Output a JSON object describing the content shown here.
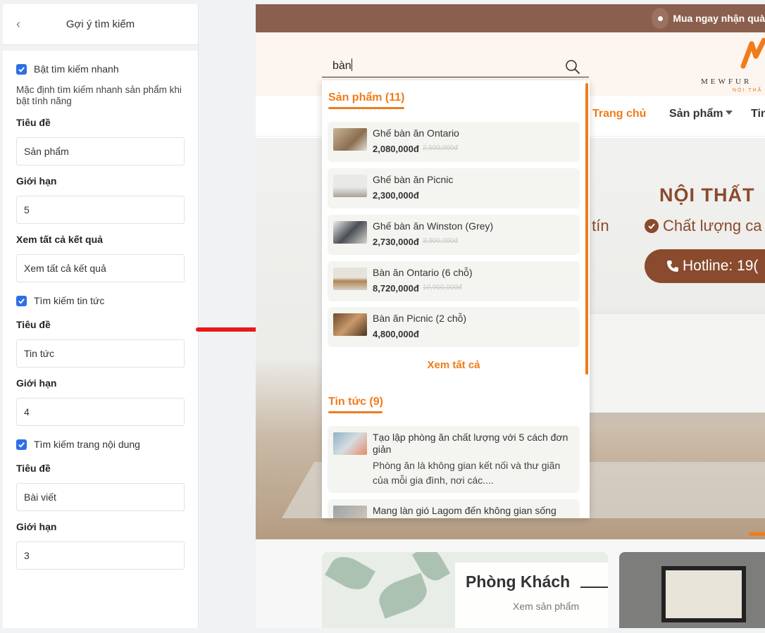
{
  "panel": {
    "title": "Gợi ý tìm kiếm",
    "quick_search": {
      "label": "Bật tìm kiếm nhanh",
      "checked": true
    },
    "note": "Mặc định tìm kiếm nhanh sản phẩm khi bật tính năng",
    "product_title_label": "Tiêu đề",
    "product_title_value": "Sản phẩm",
    "product_limit_label": "Giới hạn",
    "product_limit_value": "5",
    "view_all_label": "Xem tất cả kết quả",
    "view_all_value": "Xem tất cả kết quả",
    "news_search": {
      "label": "Tìm kiếm tin tức",
      "checked": true
    },
    "news_title_label": "Tiêu đề",
    "news_title_value": "Tin tức",
    "news_limit_label": "Giới hạn",
    "news_limit_value": "4",
    "page_search": {
      "label": "Tìm kiếm trang nội dung",
      "checked": true
    },
    "page_title_label": "Tiêu đề",
    "page_title_value": "Bài viết",
    "page_limit_label": "Giới hạn",
    "page_limit_value": "3"
  },
  "site": {
    "promo": "Mua ngay nhận quà",
    "search_value": "bàn",
    "logo_text": "MEWFUR",
    "logo_sub": "NỘI THẤ",
    "nav": [
      "Trang chủ",
      "Sản phẩm",
      "Tin"
    ],
    "hero_title": "NỘI THẤT",
    "hero_left": "y tín",
    "hero_quality": "Chất lượng ca",
    "hotline": "Hotline: 19(",
    "card1_title": "Phòng Khách",
    "card1_link": "Xem sản phẩm"
  },
  "dropdown": {
    "products_heading": "Sản phẩm (11)",
    "products": [
      {
        "name": "Ghế bàn ăn Ontario",
        "price": "2,080,000đ",
        "old_price": "2,600,000đ"
      },
      {
        "name": "Ghế bàn ăn Picnic",
        "price": "2,300,000đ",
        "old_price": ""
      },
      {
        "name": "Ghế bàn ăn Winston (Grey)",
        "price": "2,730,000đ",
        "old_price": "3,900,000đ"
      },
      {
        "name": "Bàn ăn Ontario (6 chỗ)",
        "price": "8,720,000đ",
        "old_price": "10,900,000đ"
      },
      {
        "name": "Bàn ăn Picnic (2 chỗ)",
        "price": "4,800,000đ",
        "old_price": ""
      }
    ],
    "see_all": "Xem tất cả",
    "news_heading": "Tin tức (9)",
    "news": [
      {
        "title": "Tạo lập phòng ăn chất lượng với 5 cách đơn giản",
        "excerpt": "Phòng ăn là không gian kết nối và thư giãn của mỗi gia đình, nơi các...."
      },
      {
        "title": "Mang làn gió Lagom đến không gian sống",
        "excerpt": ""
      }
    ]
  },
  "colors": {
    "accent": "#ef7c1a",
    "brown": "#8a4a2e",
    "check": "#2e6fe4",
    "arrow": "#e8191a"
  }
}
